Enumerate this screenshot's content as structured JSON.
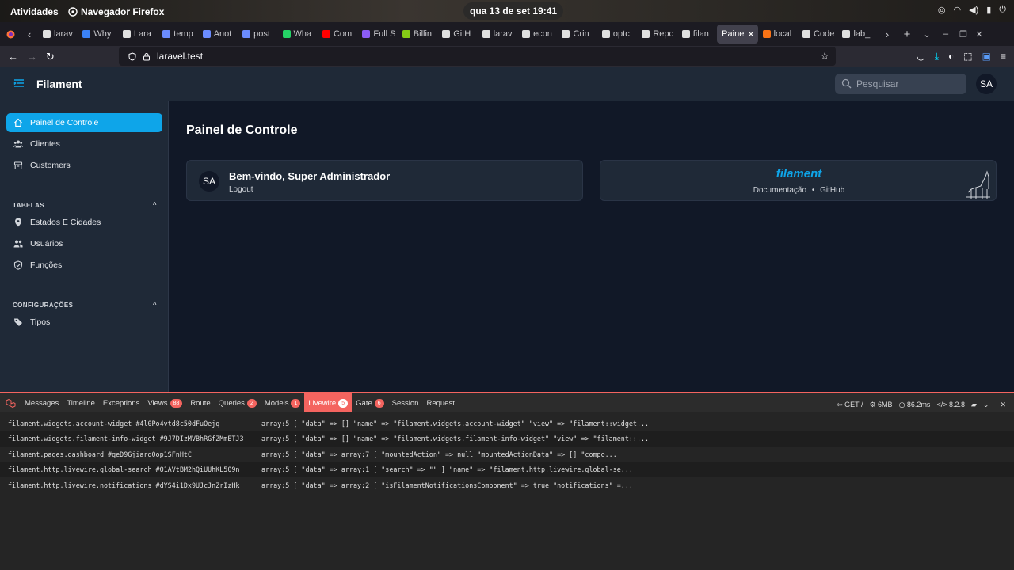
{
  "gnome": {
    "activities": "Atividades",
    "app_name": "Navegador Firefox",
    "clock": "qua 13 de set  19:41"
  },
  "browser": {
    "tabs": [
      {
        "label": "larav",
        "color": "#e0e0e0"
      },
      {
        "label": "Why",
        "color": "#3b82f6"
      },
      {
        "label": "Lara",
        "color": "#e0e0e0"
      },
      {
        "label": "temp",
        "color": "#6b8cff"
      },
      {
        "label": "Anot",
        "color": "#6b8cff"
      },
      {
        "label": "post",
        "color": "#6b8cff"
      },
      {
        "label": "Wha",
        "color": "#25d366"
      },
      {
        "label": "Com",
        "color": "#ff0000"
      },
      {
        "label": "Full S",
        "color": "#8b5cf6"
      },
      {
        "label": "Billin",
        "color": "#84cc16"
      },
      {
        "label": "GitH",
        "color": "#e0e0e0"
      },
      {
        "label": "larav",
        "color": "#e0e0e0"
      },
      {
        "label": "econ",
        "color": "#e0e0e0"
      },
      {
        "label": "Crin",
        "color": "#e0e0e0"
      },
      {
        "label": "optc",
        "color": "#e0e0e0"
      },
      {
        "label": "Repc",
        "color": "#e0e0e0"
      },
      {
        "label": "filan",
        "color": "#e0e0e0"
      },
      {
        "label": "Paine",
        "color": "#f59e0b",
        "active": true
      },
      {
        "label": "local",
        "color": "#f97316"
      },
      {
        "label": "Code",
        "color": "#e0e0e0"
      },
      {
        "label": "lab_",
        "color": "#e0e0e0"
      }
    ],
    "url": "laravel.test"
  },
  "app": {
    "brand": "Filament",
    "search_placeholder": "Pesquisar",
    "user_initials": "SA"
  },
  "sidebar": {
    "items": [
      {
        "label": "Painel de Controle",
        "icon": "home-icon",
        "active": true
      },
      {
        "label": "Clientes",
        "icon": "users-icon"
      },
      {
        "label": "Customers",
        "icon": "archive-icon"
      }
    ],
    "group1": {
      "label": "TABELAS",
      "items": [
        {
          "label": "Estados E Cidades",
          "icon": "map-pin-icon"
        },
        {
          "label": "Usuários",
          "icon": "users-icon"
        },
        {
          "label": "Funções",
          "icon": "shield-icon"
        }
      ]
    },
    "group2": {
      "label": "CONFIGURAÇÕES",
      "items": [
        {
          "label": "Tipos",
          "icon": "tag-icon"
        }
      ]
    }
  },
  "main": {
    "title": "Painel de Controle",
    "account": {
      "initials": "SA",
      "welcome": "Bem-vindo, Super Administrador",
      "logout": "Logout"
    },
    "info": {
      "logo": "filament",
      "docs": "Documentação",
      "sep": "•",
      "github": "GitHub"
    }
  },
  "debugbar": {
    "tabs": [
      {
        "label": "Messages"
      },
      {
        "label": "Timeline"
      },
      {
        "label": "Exceptions"
      },
      {
        "label": "Views",
        "badge": "88"
      },
      {
        "label": "Route"
      },
      {
        "label": "Queries",
        "badge": "2"
      },
      {
        "label": "Models",
        "badge": "1"
      },
      {
        "label": "Livewire",
        "badge": "5",
        "active": true
      },
      {
        "label": "Gate",
        "badge": "6"
      },
      {
        "label": "Session"
      },
      {
        "label": "Request"
      }
    ],
    "method": "GET /",
    "memory": "6MB",
    "time": "86.2ms",
    "php": "8.2.8",
    "rows": [
      {
        "key": "filament.widgets.account-widget #4l0Po4vtd8c50dFuOejq",
        "value": "array:5 [ \"data\" => [] \"name\" => \"filament.widgets.account-widget\" \"view\" => \"filament::widget..."
      },
      {
        "key": "filament.widgets.filament-info-widget #9J7DIzMVBhRGfZMmETJ3",
        "value": "array:5 [ \"data\" => [] \"name\" => \"filament.widgets.filament-info-widget\" \"view\" => \"filament::..."
      },
      {
        "key": "filament.pages.dashboard #geD9Gjiard0op1SFnHtC",
        "value": "array:5 [ \"data\" => array:7 [ \"mountedAction\" => null \"mountedActionData\" => [] \"compo..."
      },
      {
        "key": "filament.http.livewire.global-search #O1AVtBM2hQiUUhKL509n",
        "value": "array:5 [ \"data\" => array:1 [ \"search\" => \"\" ] \"name\" => \"filament.http.livewire.global-se..."
      },
      {
        "key": "filament.http.livewire.notifications #dYS4i1Dx9UJcJnZrIzHk",
        "value": "array:5 [ \"data\" => array:2 [ \"isFilamentNotificationsComponent\" => true \"notifications\" =..."
      }
    ]
  }
}
